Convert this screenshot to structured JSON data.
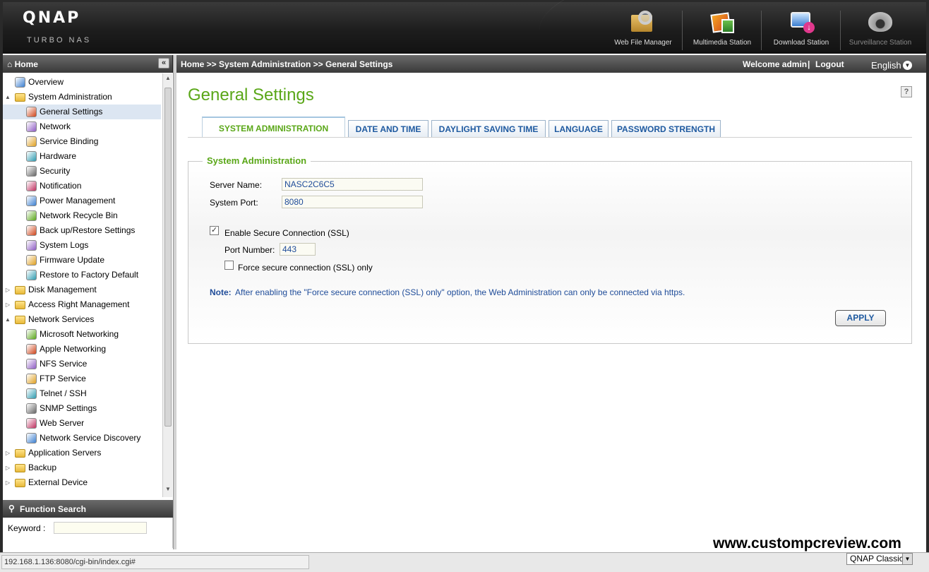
{
  "brand": {
    "logo": "QNAP",
    "subtitle": "TURBO NAS"
  },
  "apps": [
    {
      "label": "Web File Manager",
      "icon": "web-file-manager-icon"
    },
    {
      "label": "Multimedia Station",
      "icon": "multimedia-station-icon"
    },
    {
      "label": "Download Station",
      "icon": "download-station-icon"
    },
    {
      "label": "Surveillance Station",
      "icon": "surveillance-station-icon"
    }
  ],
  "sidebar": {
    "header": "Home",
    "collapse_glyph": "«",
    "items": [
      {
        "label": "Overview",
        "icon": "overview-icon",
        "level": 0,
        "twisty": ""
      },
      {
        "label": "System Administration",
        "icon": "folder-icon",
        "level": 0,
        "twisty": "▲"
      },
      {
        "label": "General Settings",
        "icon": "general-settings-icon",
        "level": 1,
        "selected": true
      },
      {
        "label": "Network",
        "icon": "network-icon",
        "level": 1
      },
      {
        "label": "Service Binding",
        "icon": "service-binding-icon",
        "level": 1
      },
      {
        "label": "Hardware",
        "icon": "hardware-icon",
        "level": 1
      },
      {
        "label": "Security",
        "icon": "security-icon",
        "level": 1
      },
      {
        "label": "Notification",
        "icon": "notification-icon",
        "level": 1
      },
      {
        "label": "Power Management",
        "icon": "power-management-icon",
        "level": 1
      },
      {
        "label": "Network Recycle Bin",
        "icon": "recycle-bin-icon",
        "level": 1
      },
      {
        "label": "Back up/Restore Settings",
        "icon": "backup-restore-icon",
        "level": 1
      },
      {
        "label": "System Logs",
        "icon": "system-logs-icon",
        "level": 1
      },
      {
        "label": "Firmware Update",
        "icon": "firmware-update-icon",
        "level": 1
      },
      {
        "label": "Restore to Factory Default",
        "icon": "factory-default-icon",
        "level": 1
      },
      {
        "label": "Disk Management",
        "icon": "folder-icon",
        "level": 0,
        "twisty": "▷"
      },
      {
        "label": "Access Right Management",
        "icon": "folder-icon",
        "level": 0,
        "twisty": "▷"
      },
      {
        "label": "Network Services",
        "icon": "folder-icon",
        "level": 0,
        "twisty": "▲"
      },
      {
        "label": "Microsoft Networking",
        "icon": "microsoft-networking-icon",
        "level": 1
      },
      {
        "label": "Apple Networking",
        "icon": "apple-networking-icon",
        "level": 1
      },
      {
        "label": "NFS Service",
        "icon": "nfs-service-icon",
        "level": 1
      },
      {
        "label": "FTP Service",
        "icon": "ftp-service-icon",
        "level": 1
      },
      {
        "label": "Telnet / SSH",
        "icon": "telnet-ssh-icon",
        "level": 1
      },
      {
        "label": "SNMP Settings",
        "icon": "snmp-settings-icon",
        "level": 1
      },
      {
        "label": "Web Server",
        "icon": "web-server-icon",
        "level": 1
      },
      {
        "label": "Network Service Discovery",
        "icon": "network-service-discovery-icon",
        "level": 1
      },
      {
        "label": "Application Servers",
        "icon": "folder-icon",
        "level": 0,
        "twisty": "▷"
      },
      {
        "label": "Backup",
        "icon": "folder-icon",
        "level": 0,
        "twisty": "▷"
      },
      {
        "label": "External Device",
        "icon": "folder-icon",
        "level": 0,
        "twisty": "▷"
      }
    ]
  },
  "function_search": {
    "header": "Function Search",
    "keyword_label": "Keyword :",
    "keyword_value": ""
  },
  "topbar": {
    "breadcrumb": "Home >> System Administration >> General Settings",
    "welcome": "Welcome admin",
    "separator": "|",
    "logout": "Logout",
    "language": "English"
  },
  "main": {
    "title": "General Settings",
    "help_glyph": "?",
    "tabs": [
      {
        "label": "SYSTEM ADMINISTRATION",
        "active": true
      },
      {
        "label": "DATE AND TIME"
      },
      {
        "label": "DAYLIGHT SAVING TIME"
      },
      {
        "label": "LANGUAGE"
      },
      {
        "label": "PASSWORD STRENGTH"
      }
    ],
    "section_title": "System Administration",
    "server_name_label": "Server Name:",
    "server_name_value": "NASC2C6C5",
    "system_port_label": "System Port:",
    "system_port_value": "8080",
    "ssl_label": "Enable Secure Connection (SSL)",
    "ssl_checked": true,
    "port_number_label": "Port Number:",
    "port_number_value": "443",
    "force_ssl_label": "Force secure connection (SSL) only",
    "force_ssl_checked": false,
    "note_label": "Note:",
    "note_text": "After enabling the \"Force secure connection (SSL) only\" option, the Web Administration can only be connected via https.",
    "apply_label": "APPLY"
  },
  "watermark": "www.custompcreview.com",
  "status_bar": {
    "url": "192.168.1.136:8080/cgi-bin/index.cgi#",
    "theme": "QNAP Classic"
  },
  "colors": {
    "accent_green": "#5aa718",
    "link_blue": "#1f5aa0",
    "header_dark": "#1d1d1d"
  }
}
